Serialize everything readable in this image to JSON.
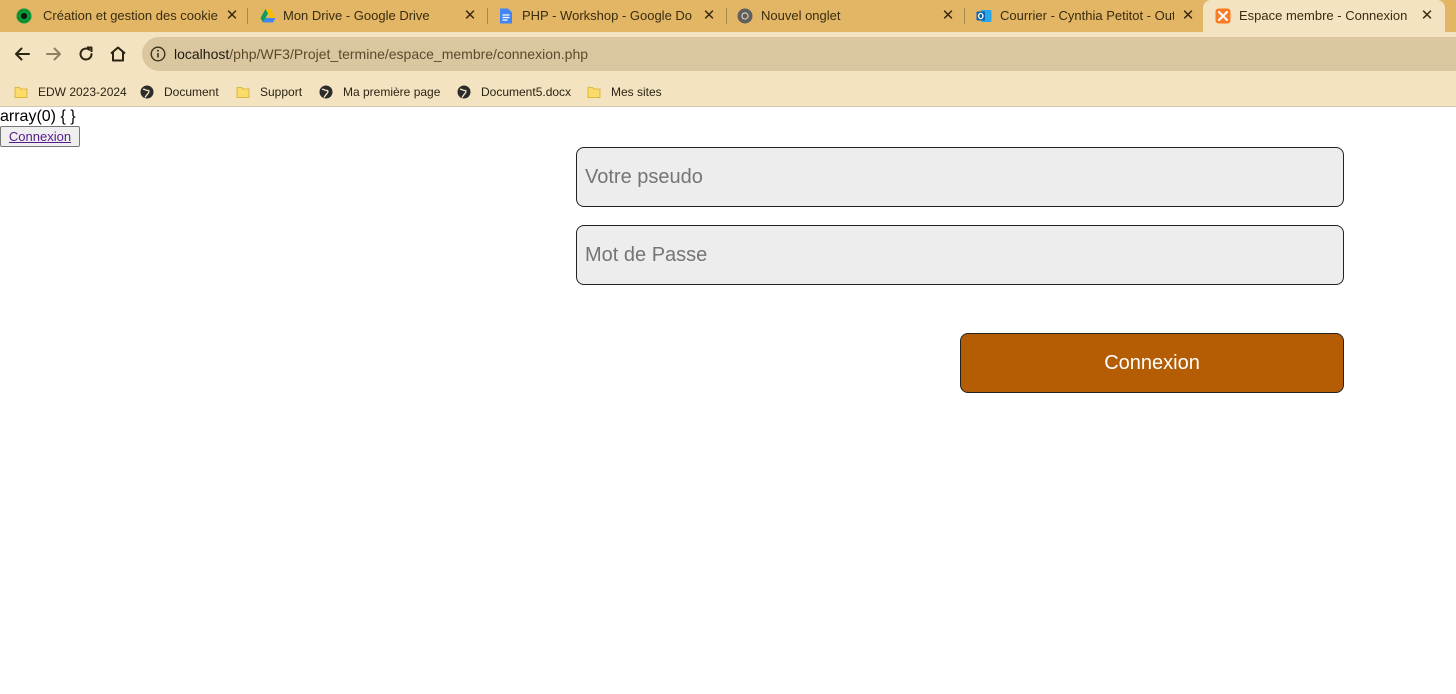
{
  "browser": {
    "tabs": [
      {
        "title": "Création et gestion des cookies e",
        "icon": "green-globe-icon"
      },
      {
        "title": "Mon Drive - Google Drive",
        "icon": "google-drive-icon"
      },
      {
        "title": "PHP - Workshop - Google Docs",
        "icon": "google-docs-icon"
      },
      {
        "title": "Nouvel onglet",
        "icon": "chrome-icon"
      },
      {
        "title": "Courrier - Cynthia Petitot - Outlo",
        "icon": "outlook-icon"
      },
      {
        "title": "Espace membre - Connexion",
        "icon": "xampp-icon",
        "active": true
      }
    ],
    "address_bar": {
      "host": "localhost",
      "path": "/php/WF3/Projet_termine/espace_membre/connexion.php"
    },
    "bookmarks": [
      {
        "label": "EDW 2023-2024",
        "icon": "folder-icon"
      },
      {
        "label": "Document",
        "icon": "globe-icon"
      },
      {
        "label": "Support",
        "icon": "folder-icon"
      },
      {
        "label": "Ma première page",
        "icon": "globe-icon"
      },
      {
        "label": "Document5.docx",
        "icon": "globe-icon"
      },
      {
        "label": "Mes sites",
        "icon": "folder-icon"
      }
    ]
  },
  "page": {
    "debug_output": "array(0) { }",
    "top_link_button": "Connexion",
    "form": {
      "pseudo_placeholder": "Votre pseudo",
      "password_placeholder": "Mot de Passe",
      "submit_label": "Connexion"
    }
  },
  "colors": {
    "tabstrip": "#e2b665",
    "toolbar": "#f3e3c1",
    "submit_button": "#b45d04",
    "input_background": "#ededed"
  }
}
